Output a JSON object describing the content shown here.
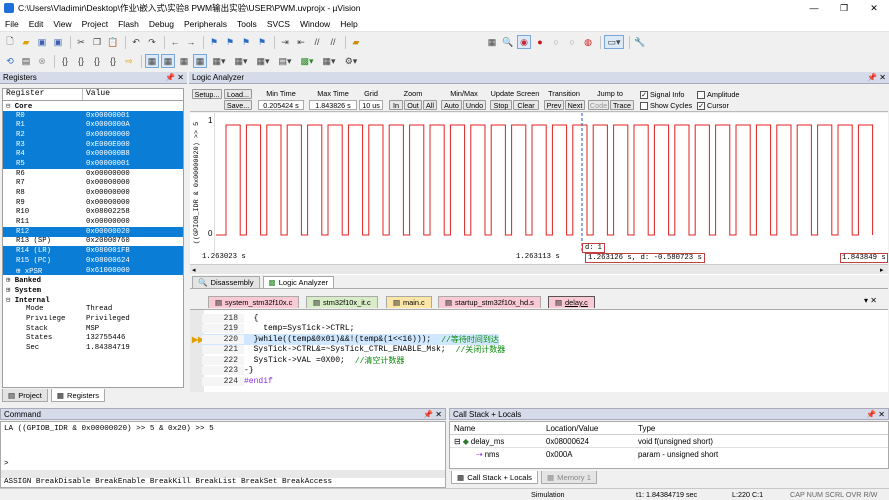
{
  "window": {
    "title": "C:\\Users\\Vladimir\\Desktop\\作业\\嵌入式\\实验8 PWM输出实验\\USER\\PWM.uvprojx - µVision",
    "minimize": "—",
    "restore": "❐",
    "close": "✕"
  },
  "menu": [
    "File",
    "Edit",
    "View",
    "Project",
    "Flash",
    "Debug",
    "Peripherals",
    "Tools",
    "SVCS",
    "Window",
    "Help"
  ],
  "registers": {
    "title": "Registers",
    "columns": [
      "Register",
      "Value"
    ],
    "rows": [
      {
        "name": "Core",
        "value": "",
        "sel": false,
        "indent": 0,
        "tree": "⊟"
      },
      {
        "name": "R0",
        "value": "0x00000001",
        "sel": true,
        "indent": 1
      },
      {
        "name": "R1",
        "value": "0x0000000A",
        "sel": true,
        "indent": 1
      },
      {
        "name": "R2",
        "value": "0x00000000",
        "sel": true,
        "indent": 1
      },
      {
        "name": "R3",
        "value": "0xE000E000",
        "sel": true,
        "indent": 1
      },
      {
        "name": "R4",
        "value": "0x000000B8",
        "sel": true,
        "indent": 1
      },
      {
        "name": "R5",
        "value": "0x00000001",
        "sel": true,
        "indent": 1
      },
      {
        "name": "R6",
        "value": "0x00000000",
        "sel": false,
        "indent": 1
      },
      {
        "name": "R7",
        "value": "0x00000000",
        "sel": false,
        "indent": 1
      },
      {
        "name": "R8",
        "value": "0x00000000",
        "sel": false,
        "indent": 1
      },
      {
        "name": "R9",
        "value": "0x00000000",
        "sel": false,
        "indent": 1
      },
      {
        "name": "R10",
        "value": "0x08002258",
        "sel": false,
        "indent": 1
      },
      {
        "name": "R11",
        "value": "0x00000000",
        "sel": false,
        "indent": 1
      },
      {
        "name": "R12",
        "value": "0x00000020",
        "sel": true,
        "indent": 1
      },
      {
        "name": "R13 (SP)",
        "value": "0x20000760",
        "sel": false,
        "indent": 1
      },
      {
        "name": "R14 (LR)",
        "value": "0x080001FB",
        "sel": true,
        "indent": 1
      },
      {
        "name": "R15 (PC)",
        "value": "0x08000624",
        "sel": true,
        "indent": 1
      },
      {
        "name": "xPSR",
        "value": "0x61000000",
        "sel": true,
        "indent": 1,
        "tree": "⊞"
      },
      {
        "name": "Banked",
        "value": "",
        "sel": false,
        "indent": 0,
        "tree": "⊞"
      },
      {
        "name": "System",
        "value": "",
        "sel": false,
        "indent": 0,
        "tree": "⊞"
      },
      {
        "name": "Internal",
        "value": "",
        "sel": false,
        "indent": 0,
        "tree": "⊟"
      },
      {
        "name": "Mode",
        "value": "Thread",
        "sel": false,
        "indent": 2
      },
      {
        "name": "Privilege",
        "value": "Privileged",
        "sel": false,
        "indent": 2
      },
      {
        "name": "Stack",
        "value": "MSP",
        "sel": false,
        "indent": 2
      },
      {
        "name": "States",
        "value": "132755446",
        "sel": false,
        "indent": 2
      },
      {
        "name": "Sec",
        "value": "1.84384719",
        "sel": false,
        "indent": 2
      }
    ],
    "tabs": [
      "Project",
      "Registers"
    ]
  },
  "logic_analyzer": {
    "title": "Logic Analyzer",
    "setup": "Setup...",
    "load": "Load...",
    "save": "Save...",
    "min_time_label": "Min Time",
    "min_time": "0.205424 s",
    "max_time_label": "Max Time",
    "max_time": "1.843826 s",
    "grid_label": "Grid",
    "grid": "10 us",
    "zoom_label": "Zoom",
    "zoom_in": "In",
    "zoom_out": "Out",
    "zoom_all": "All",
    "minmax_label": "Min/Max",
    "auto": "Auto",
    "undo": "Undo",
    "update_label": "Update Screen",
    "stop": "Stop",
    "clear": "Clear",
    "transition_label": "Transition",
    "prev": "Prev",
    "next": "Next",
    "jump_label": "Jump to",
    "code": "Code",
    "trace": "Trace",
    "signal_info": "Signal Info",
    "show_cycles": "Show Cycles",
    "amplitude": "Amplitude",
    "cursor": "Cursor",
    "signal_name": "((GPIOB_IDR & 0x00000020) >> 5",
    "y_high": "1",
    "y_low": "0",
    "t_left": "1.263023 s",
    "t_mid": "1.263113 s",
    "t_right": "1.843849 s",
    "cursor_d": "d: 1",
    "cursor_info": "1.263126 s,  d: -0.580723 s",
    "bottom_tabs": [
      "Disassembly",
      "Logic Analyzer"
    ]
  },
  "file_tabs": [
    "system_stm32f10x.c",
    "stm32f10x_it.c",
    "main.c",
    "startup_stm32f10x_hd.s",
    "delay.c"
  ],
  "code_lines": [
    {
      "n": "218",
      "t": "  {"
    },
    {
      "n": "219",
      "t": "    temp=SysTick->CTRL;"
    },
    {
      "n": "220",
      "t": "  }while((temp&0x01)&&!(temp&(1<<16)));",
      "c": "//等待时间到达"
    },
    {
      "n": "221",
      "t": "  SysTick->CTRL&=~SysTick_CTRL_ENABLE_Msk;",
      "c": "//关闭计数器"
    },
    {
      "n": "222",
      "t": "  SysTick->VAL =0X00;",
      "c": "//清空计数器"
    },
    {
      "n": "223",
      "t": "-}"
    },
    {
      "n": "224",
      "t": "#endif"
    }
  ],
  "command": {
    "title": "Command",
    "line1": "LA ((GPIOB_IDR & 0x00000020) >> 5 & 0x20) >> 5",
    "prompt": ">",
    "autocomplete": "ASSIGN BreakDisable BreakEnable BreakKill BreakList BreakSet BreakAccess"
  },
  "callstack": {
    "title": "Call Stack + Locals",
    "columns": [
      "Name",
      "Location/Value",
      "Type"
    ],
    "rows": [
      {
        "name": "delay_ms",
        "loc": "0x08000624",
        "type": "void f(unsigned short)"
      },
      {
        "name": "nms",
        "loc": "0x000A",
        "type": "param - unsigned short"
      }
    ],
    "tabs": [
      "Call Stack + Locals",
      "Memory 1"
    ]
  },
  "status": {
    "mode": "Simulation",
    "time": "t1: 1.84384719 sec",
    "pos": "L:220 C:1",
    "flags": "CAP  NUM  SCRL  OVR  R/W"
  },
  "colors": {
    "accent": "#0a7ed6",
    "signal": "#e02020",
    "panel_header": "#d6dbe9"
  }
}
